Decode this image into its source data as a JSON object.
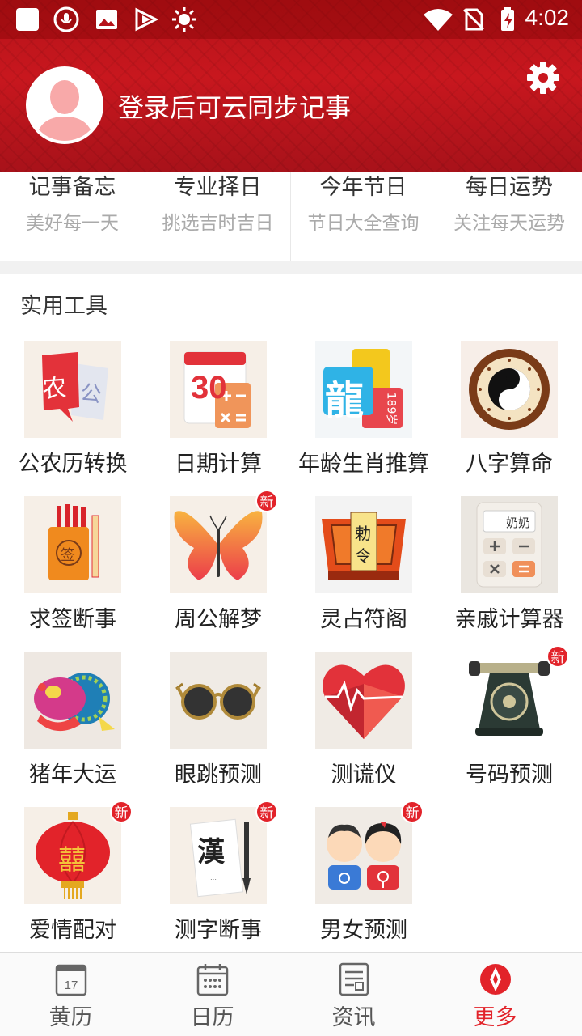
{
  "status_bar": {
    "time": "4:02",
    "icons": [
      "app-square-icon",
      "voice-recorder-icon",
      "gallery-icon",
      "media-play-icon",
      "brightness-icon",
      "wifi-icon",
      "no-sim-icon",
      "battery-charging-icon"
    ]
  },
  "header": {
    "login_text": "登录后可云同步记事",
    "settings_icon": "gear-icon",
    "accent": "#c8171e"
  },
  "quick_links": [
    {
      "title": "记事备忘",
      "subtitle": "美好每一天"
    },
    {
      "title": "专业择日",
      "subtitle": "挑选吉时吉日"
    },
    {
      "title": "今年节日",
      "subtitle": "节日大全查询"
    },
    {
      "title": "每日运势",
      "subtitle": "关注每天运势"
    }
  ],
  "tools": {
    "section_title": "实用工具",
    "items": [
      {
        "label": "公农历转换",
        "icon": "calendar-convert-icon"
      },
      {
        "label": "日期计算",
        "icon": "date-calculator-icon",
        "day_number": "30"
      },
      {
        "label": "年龄生肖推算",
        "icon": "zodiac-dragon-icon",
        "glyph": "龍",
        "card_text": "189岁"
      },
      {
        "label": "八字算命",
        "icon": "bagua-yinyang-icon"
      },
      {
        "label": "求签断事",
        "icon": "fortune-sticks-icon",
        "glyph": "签"
      },
      {
        "label": "周公解梦",
        "icon": "butterfly-icon",
        "badge": "新"
      },
      {
        "label": "灵占符阁",
        "icon": "talisman-icon",
        "glyph_top": "勅",
        "glyph_bottom": "令"
      },
      {
        "label": "亲戚计算器",
        "icon": "relative-calculator-icon",
        "display": "奶奶"
      },
      {
        "label": "猪年大运",
        "icon": "pig-fish-icon"
      },
      {
        "label": "眼跳预测",
        "icon": "sunglasses-icon"
      },
      {
        "label": "测谎仪",
        "icon": "heart-pulse-icon"
      },
      {
        "label": "号码预测",
        "icon": "rotary-phone-icon",
        "badge": "新"
      },
      {
        "label": "爱情配对",
        "icon": "red-lantern-icon",
        "badge": "新",
        "glyph": "囍"
      },
      {
        "label": "测字断事",
        "icon": "calligraphy-brush-icon",
        "badge": "新",
        "glyph": "漢"
      },
      {
        "label": "男女预测",
        "icon": "boy-girl-icon",
        "badge": "新"
      }
    ]
  },
  "bottom_nav": [
    {
      "label": "黄历",
      "icon": "almanac-icon",
      "day": "17",
      "active": false
    },
    {
      "label": "日历",
      "icon": "calendar-icon",
      "active": false
    },
    {
      "label": "资讯",
      "icon": "news-icon",
      "active": false
    },
    {
      "label": "更多",
      "icon": "compass-more-icon",
      "active": true
    }
  ],
  "colors": {
    "active": "#e2232a",
    "badge": "#e2232a"
  }
}
